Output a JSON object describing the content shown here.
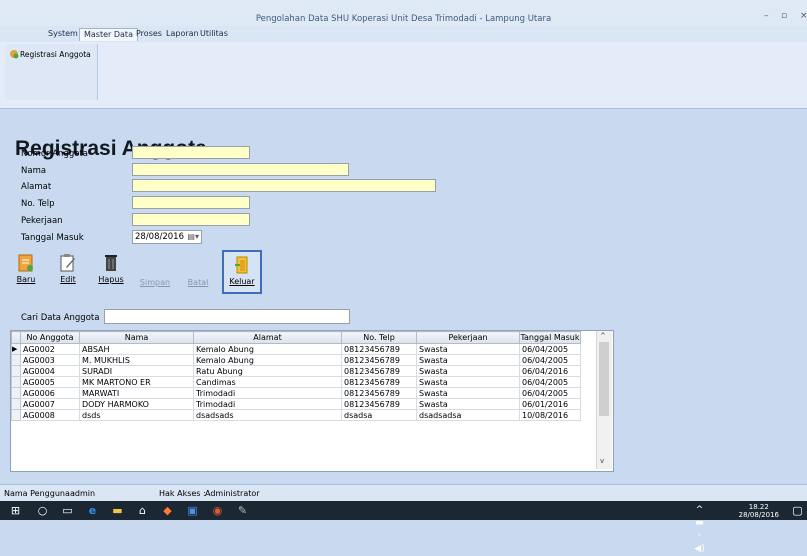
{
  "window": {
    "title": "Pengolahan Data SHU Koperasi Unit Desa Trimodadi - Lampung Utara",
    "minimize": "–",
    "maximize": "▫",
    "close": "×"
  },
  "menu": [
    "System",
    "Master Data",
    "Proses",
    "Laporan",
    "Utilitas"
  ],
  "ribbon": {
    "button_label": "Registrasi Anggota"
  },
  "form": {
    "title": "Registrasi Anggota",
    "labels": {
      "nomor": "Nomor Anggota",
      "nama": "Nama",
      "alamat": "Alamat",
      "telp": "No. Telp",
      "pekerjaan": "Pekerjaan",
      "tanggal": "Tanggal Masuk"
    },
    "values": {
      "nomor": "",
      "nama": "",
      "alamat": "",
      "telp": "",
      "pekerjaan": "",
      "tanggal": "28/08/2016"
    }
  },
  "toolbar": {
    "baru": "Baru",
    "edit": "Edit",
    "hapus": "Hapus",
    "simpan": "Simpan",
    "batal": "Batal",
    "keluar": "Keluar"
  },
  "search": {
    "label": "Cari Data Anggota",
    "value": ""
  },
  "table": {
    "headers": [
      "No Anggota",
      "Nama",
      "Alamat",
      "No. Telp",
      "Pekerjaan",
      "Tanggal Masuk"
    ],
    "rows": [
      [
        "AG0002",
        "ABSAH",
        "Kemalo Abung",
        "08123456789",
        "Swasta",
        "06/04/2005"
      ],
      [
        "AG0003",
        "M. MUKHLIS",
        "Kemalo Abung",
        "08123456789",
        "Swasta",
        "06/04/2005"
      ],
      [
        "AG0004",
        "SURADI",
        "Ratu Abung",
        "08123456789",
        "Swasta",
        "06/04/2016"
      ],
      [
        "AG0005",
        "MK MARTONO ER",
        "Candimas",
        "08123456789",
        "Swasta",
        "06/04/2005"
      ],
      [
        "AG0006",
        "MARWATI",
        "Trimodadi",
        "08123456789",
        "Swasta",
        "06/04/2005"
      ],
      [
        "AG0007",
        "DODY HARMOKO",
        "Trimodadi",
        "08123456789",
        "Swasta",
        "06/01/2016"
      ],
      [
        "AG0008",
        "dsds",
        "dsadsads",
        "dsadsa",
        "dsadsadsa",
        "10/08/2016"
      ]
    ]
  },
  "status": {
    "user_label": "Nama Pengguna :",
    "user": "admin",
    "access_label": "Hak Akses :",
    "access": "Administrator"
  },
  "taskbar": {
    "time": "18.22",
    "date": "28/08/2016"
  },
  "colors": {
    "field_bg": "#ffffc8",
    "content_bg": "#c9daf0",
    "taskbar": "#1c2734"
  }
}
